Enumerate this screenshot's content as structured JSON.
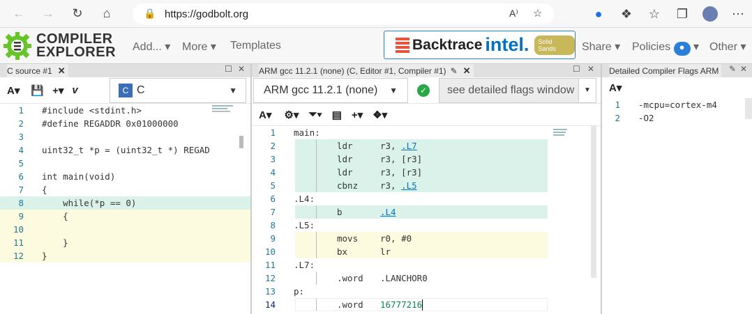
{
  "browser": {
    "url": "https://godbolt.org",
    "icons": [
      "back-icon",
      "forward-icon",
      "refresh-icon",
      "home-icon"
    ],
    "read_aloud": "A⁾"
  },
  "header": {
    "logo_line1": "COMPILER",
    "logo_line2": "EXPLORER",
    "menu": [
      "Add...",
      "More",
      "Templates"
    ],
    "right_menu": [
      "Share",
      "Policies",
      "Other"
    ],
    "sponsor1": "Backtrace",
    "sponsor2": "intel.",
    "sponsor3": "Solid Sands"
  },
  "source_pane": {
    "tab": "C source #1",
    "language": "C",
    "lines": [
      {
        "n": "1",
        "text": "#include <stdint.h>"
      },
      {
        "n": "2",
        "text": "#define REGADDR 0x01000000"
      },
      {
        "n": "3",
        "text": ""
      },
      {
        "n": "4",
        "text": "uint32_t *p = (uint32_t *) REGAD"
      },
      {
        "n": "5",
        "text": ""
      },
      {
        "n": "6",
        "text": "int main(void)"
      },
      {
        "n": "7",
        "text": "{"
      },
      {
        "n": "8",
        "text": "    while(*p == 0)"
      },
      {
        "n": "9",
        "text": "    {"
      },
      {
        "n": "10",
        "text": ""
      },
      {
        "n": "11",
        "text": "    }"
      },
      {
        "n": "12",
        "text": "}"
      }
    ]
  },
  "asm_pane": {
    "tab": "ARM gcc 11.2.1 (none) (C, Editor #1, Compiler #1)",
    "compiler": "ARM gcc 11.2.1 (none)",
    "flags_placeholder": "see detailed flags window",
    "lines": [
      {
        "n": "1",
        "label": "main:"
      },
      {
        "n": "2",
        "op": "ldr",
        "args": "r3, ",
        "link": ".L7"
      },
      {
        "n": "3",
        "op": "ldr",
        "args": "r3, [r3]"
      },
      {
        "n": "4",
        "op": "ldr",
        "args": "r3, [r3]"
      },
      {
        "n": "5",
        "op": "cbnz",
        "args": "r3, ",
        "link": ".L5"
      },
      {
        "n": "6",
        "label": ".L4:"
      },
      {
        "n": "7",
        "op": "b",
        "args": "",
        "link": ".L4"
      },
      {
        "n": "8",
        "label": ".L5:"
      },
      {
        "n": "9",
        "op": "movs",
        "args": "r0, #0"
      },
      {
        "n": "10",
        "op": "bx",
        "args": "lr"
      },
      {
        "n": "11",
        "label": ".L7:"
      },
      {
        "n": "12",
        "op": ".word",
        "args": ".LANCHOR0"
      },
      {
        "n": "13",
        "label": "p:"
      },
      {
        "n": "14",
        "op": ".word",
        "args": "16777216"
      }
    ]
  },
  "flags_pane": {
    "tab": "Detailed Compiler Flags ARM",
    "lines": [
      {
        "n": "1",
        "text": "-mcpu=cortex-m4"
      },
      {
        "n": "2",
        "text": "-O2"
      }
    ]
  },
  "colors": {
    "highlight_green": "#daf2ea",
    "highlight_yellow": "#fdfbdf",
    "accent": "#2b7fd8"
  }
}
